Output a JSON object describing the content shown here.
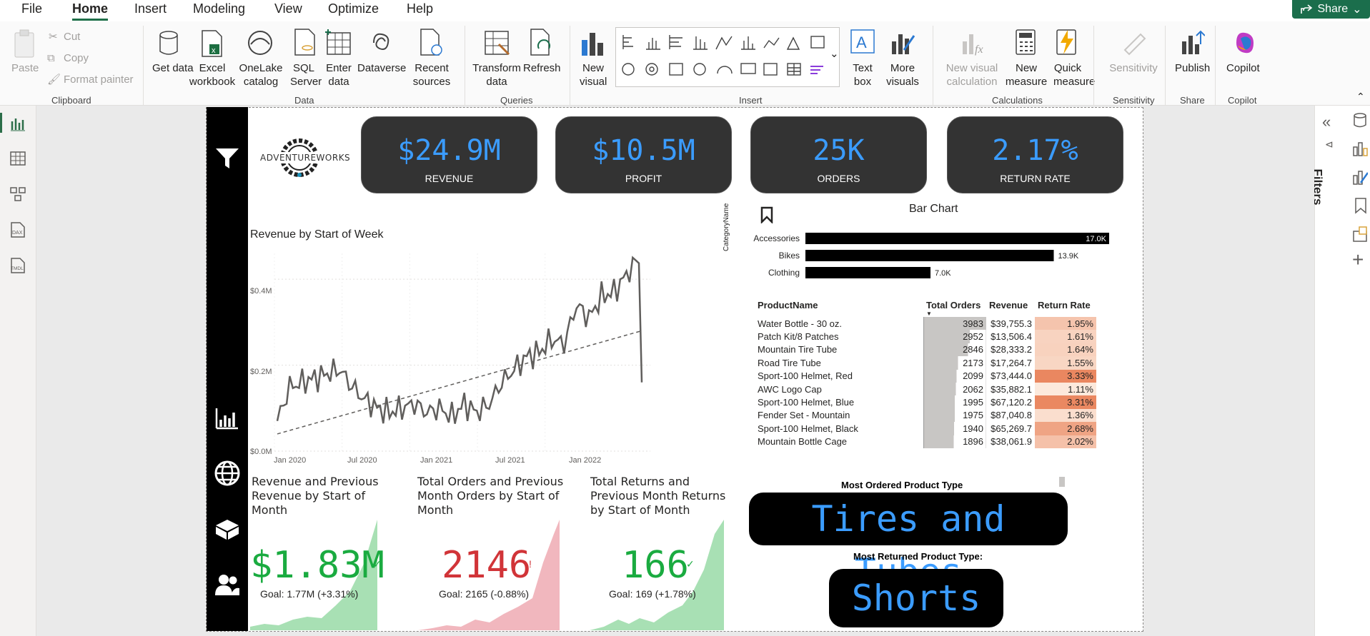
{
  "menu": {
    "items": [
      "File",
      "Home",
      "Insert",
      "Modeling",
      "View",
      "Optimize",
      "Help"
    ],
    "active": "Home",
    "share": "Share"
  },
  "ribbon": {
    "clipboard": {
      "paste": "Paste",
      "cut": "Cut",
      "copy": "Copy",
      "format_painter": "Format painter",
      "group": "Clipboard"
    },
    "data": {
      "get_data": "Get data",
      "excel": "Excel workbook",
      "onelake": "OneLake catalog",
      "sql": "SQL Server",
      "enter": "Enter data",
      "dataverse": "Dataverse",
      "recent": "Recent sources",
      "group": "Data"
    },
    "queries": {
      "transform": "Transform data",
      "refresh": "Refresh",
      "group": "Queries"
    },
    "insert": {
      "new_visual": "New visual",
      "text_box": "Text box",
      "more_visuals": "More visuals",
      "group": "Insert"
    },
    "calculations": {
      "new_visual_calc": "New visual calculation",
      "new_measure": "New measure",
      "quick_measure": "Quick measure",
      "group": "Calculations"
    },
    "sensitivity": {
      "label": "Sensitivity",
      "group": "Sensitivity"
    },
    "share": {
      "publish": "Publish",
      "group": "Share"
    },
    "copilot": {
      "label": "Copilot",
      "group": "Copilot"
    }
  },
  "right_panel": {
    "filters": "Filters"
  },
  "logo": {
    "text": "ADVENTUREWORKS"
  },
  "kpis": [
    {
      "value": "$24.9M",
      "label": "REVENUE"
    },
    {
      "value": "$10.5M",
      "label": "PROFIT"
    },
    {
      "value": "25K",
      "label": "ORDERS"
    },
    {
      "value": "2.17%",
      "label": "RETURN RATE"
    }
  ],
  "line_chart": {
    "title": "Revenue by Start of Week",
    "y_ticks": [
      "$0.0M",
      "$0.2M",
      "$0.4M"
    ],
    "x_ticks": [
      "Jan 2020",
      "Jul 2020",
      "Jan 2021",
      "Jul 2021",
      "Jan 2022"
    ]
  },
  "chart_data": {
    "type": "line",
    "title": "Revenue by Start of Week",
    "ylim": [
      0,
      0.46
    ],
    "ylabel": "",
    "x": [
      "2020-01",
      "2020-02",
      "2020-03",
      "2020-04",
      "2020-05",
      "2020-06",
      "2020-07",
      "2020-08",
      "2020-09",
      "2020-10",
      "2020-11",
      "2020-12",
      "2021-01",
      "2021-02",
      "2021-03",
      "2021-04",
      "2021-05",
      "2021-06",
      "2021-07",
      "2021-08",
      "2021-09",
      "2021-10",
      "2021-11",
      "2021-12",
      "2022-01",
      "2022-02",
      "2022-03",
      "2022-04",
      "2022-05",
      "2022-06"
    ],
    "series": [
      {
        "values": [
          0.07,
          0.15,
          0.16,
          0.17,
          0.18,
          0.19,
          0.15,
          0.12,
          0.1,
          0.09,
          0.1,
          0.11,
          0.09,
          0.1,
          0.08,
          0.11,
          0.09,
          0.11,
          0.16,
          0.19,
          0.22,
          0.23,
          0.26,
          0.25,
          0.34,
          0.31,
          0.36,
          0.37,
          0.41,
          0.45
        ]
      }
    ]
  },
  "bar_chart": {
    "title": "Bar Chart",
    "axis_label": "CategoryName",
    "categories": [
      "Accessories",
      "Bikes",
      "Clothing"
    ],
    "values": [
      17.0,
      13.9,
      7.0
    ],
    "labels": [
      "17.0K",
      "13.9K",
      "7.0K"
    ]
  },
  "table": {
    "headers": [
      "ProductName",
      "Total Orders",
      "Revenue",
      "Return Rate"
    ],
    "rows": [
      [
        "Water Bottle - 30 oz.",
        "3983",
        "$39,755.3",
        "1.95%"
      ],
      [
        "Patch Kit/8 Patches",
        "2952",
        "$13,506.4",
        "1.61%"
      ],
      [
        "Mountain Tire Tube",
        "2846",
        "$28,333.2",
        "1.64%"
      ],
      [
        "Road Tire Tube",
        "2173",
        "$17,264.7",
        "1.55%"
      ],
      [
        "Sport-100 Helmet, Red",
        "2099",
        "$73,444.0",
        "3.33%"
      ],
      [
        "AWC Logo Cap",
        "2062",
        "$35,882.1",
        "1.11%"
      ],
      [
        "Sport-100 Helmet, Blue",
        "1995",
        "$67,120.2",
        "3.31%"
      ],
      [
        "Fender Set - Mountain",
        "1975",
        "$87,040.8",
        "1.36%"
      ],
      [
        "Sport-100 Helmet, Black",
        "1940",
        "$65,269.7",
        "2.68%"
      ],
      [
        "Mountain Bottle Cage",
        "1896",
        "$38,061.9",
        "2.02%"
      ]
    ]
  },
  "cards": [
    {
      "title": "Revenue and Previous Revenue by Start of Month",
      "value": "$1.83M",
      "goal": "Goal: 1.77M (+3.31%)",
      "color": "#1aab40",
      "fill": "#a8e0b4",
      "status": "✓"
    },
    {
      "title": "Total Orders and Previous Month Orders by Start of Month",
      "value": "2146",
      "goal": "Goal: 2165 (-0.88%)",
      "color": "#d13438",
      "fill": "#f1b7be",
      "status": "!"
    },
    {
      "title": "Total Returns and Previous Month Returns by Start of Month",
      "value": "166",
      "goal": "Goal: 169 (+1.78%)",
      "color": "#1aab40",
      "fill": "#a8e0b4",
      "status": "✓"
    }
  ],
  "most_ordered": {
    "label": "Most Ordered  Product Type",
    "value": "Tires and Tubes"
  },
  "most_returned": {
    "label": "Most Returned Product Type:",
    "value": "Shorts"
  }
}
